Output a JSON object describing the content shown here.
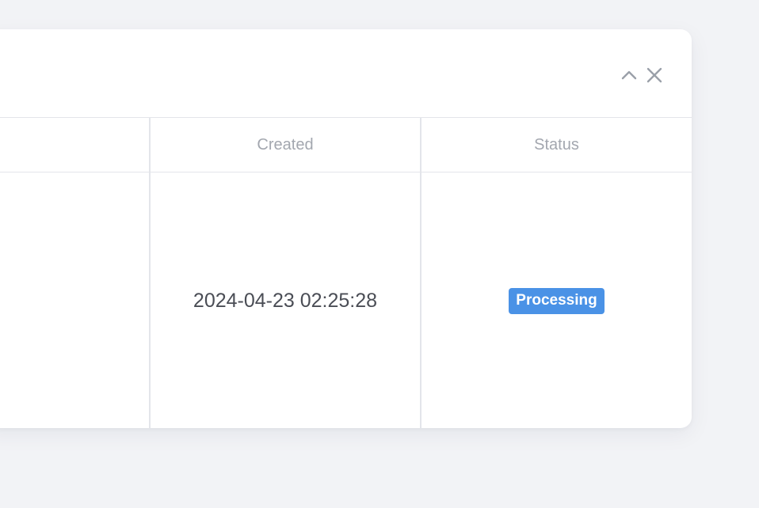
{
  "header": {
    "actions": [
      {
        "name": "collapse",
        "icon": "chevron-up-icon"
      },
      {
        "name": "close",
        "icon": "close-icon"
      }
    ]
  },
  "table": {
    "columns": [
      "",
      "Created",
      "Status"
    ],
    "rows": [
      {
        "name": "",
        "created": "2024-04-23 02:25:28",
        "status": "Processing"
      }
    ]
  },
  "colors": {
    "background": "#f2f3f6",
    "panel": "#ffffff",
    "border": "#e3e5ea",
    "header_text": "#a3a7af",
    "cell_text": "#4a4d55",
    "status_processing": "#4a92e6",
    "icon": "#9aa0a9"
  }
}
